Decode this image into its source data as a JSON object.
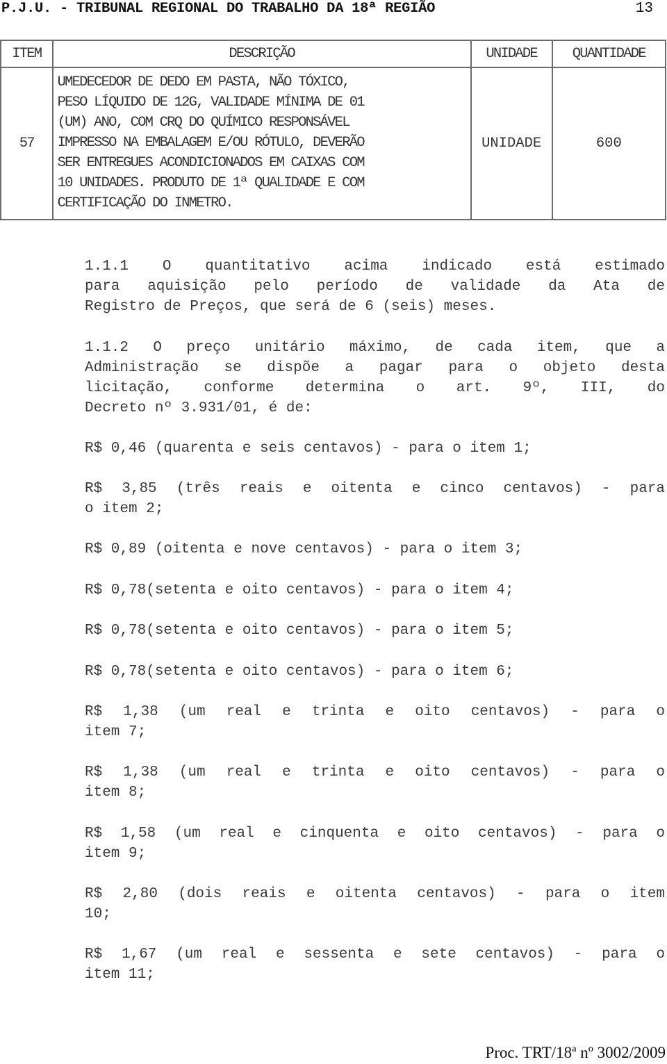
{
  "header": {
    "title": "P.J.U. - TRIBUNAL REGIONAL DO TRABALHO DA 18ª REGIÃO",
    "page_number": "13"
  },
  "table": {
    "columns": [
      "ITEM",
      "DESCRIÇÃO",
      "UNIDADE",
      "QUANTIDADE"
    ],
    "rows": [
      {
        "item": "57",
        "description_lines": [
          "UMEDECEDOR DE DEDO EM PASTA, NÃO TÓXICO,",
          "PESO LÍQUIDO DE 12G, VALIDADE MÍNIMA DE 01",
          "(UM) ANO, COM CRQ DO QUÍMICO RESPONSÁVEL",
          "IMPRESSO NA EMBALAGEM E/OU RÓTULO, DEVERÃO",
          "SER ENTREGUES ACONDICIONADOS EM CAIXAS COM",
          "10 UNIDADES. PRODUTO DE 1ª QUALIDADE E COM",
          "CERTIFICAÇÃO DO INMETRO."
        ],
        "unit": "UNIDADE",
        "quantity": "600"
      }
    ]
  },
  "clauses": [
    {
      "id": "1.1.1",
      "lines": [
        "1.1.1  O quantitativo acima indicado está estimado",
        "para aquisição pelo período de validade da Ata de",
        "Registro de Preços, que será de 6 (seis) meses."
      ]
    },
    {
      "id": "1.1.2",
      "lines": [
        "1.1.2 O preço unitário máximo, de cada item, que a",
        "Administração se dispõe a pagar para o objeto desta",
        "licitação, conforme determina o art. 9º, III, do",
        "Decreto nº 3.931/01, é de:"
      ]
    }
  ],
  "prices": [
    {
      "item": 1,
      "value": "R$ 0,46",
      "lines": [
        "R$ 0,46 (quarenta e seis centavos) - para o item 1;"
      ]
    },
    {
      "item": 2,
      "value": "R$ 3,85",
      "lines": [
        "R$ 3,85 (três reais e oitenta e cinco centavos) - para",
        "o item 2;"
      ]
    },
    {
      "item": 3,
      "value": "R$ 0,89",
      "lines": [
        "R$ 0,89 (oitenta e nove centavos) - para o item 3;"
      ]
    },
    {
      "item": 4,
      "value": "R$ 0,78",
      "lines": [
        "R$ 0,78(setenta e oito centavos) - para o item 4;"
      ]
    },
    {
      "item": 5,
      "value": "R$ 0,78",
      "lines": [
        "R$ 0,78(setenta e oito centavos) - para o item 5;"
      ]
    },
    {
      "item": 6,
      "value": "R$ 0,78",
      "lines": [
        "R$ 0,78(setenta e oito centavos) - para o item 6;"
      ]
    },
    {
      "item": 7,
      "value": "R$ 1,38",
      "lines": [
        "R$ 1,38 (um real e trinta e oito centavos) - para o",
        "item 7;"
      ]
    },
    {
      "item": 8,
      "value": "R$ 1,38",
      "lines": [
        "R$ 1,38 (um real e trinta e oito centavos) - para o",
        "item 8;"
      ]
    },
    {
      "item": 9,
      "value": "R$ 1,58",
      "lines": [
        "R$ 1,58 (um real e cinquenta e oito centavos) - para o",
        "item 9;"
      ]
    },
    {
      "item": 10,
      "value": "R$ 2,80",
      "lines": [
        "R$ 2,80 (dois reais e oitenta centavos) - para o item",
        "10;"
      ]
    },
    {
      "item": 11,
      "value": "R$ 1,67",
      "lines": [
        "R$ 1,67 (um real e sessenta e sete centavos) - para o",
        "item 11;"
      ]
    }
  ],
  "footer": {
    "process_number": "Proc. TRT/18ª nº 3002/2009"
  }
}
